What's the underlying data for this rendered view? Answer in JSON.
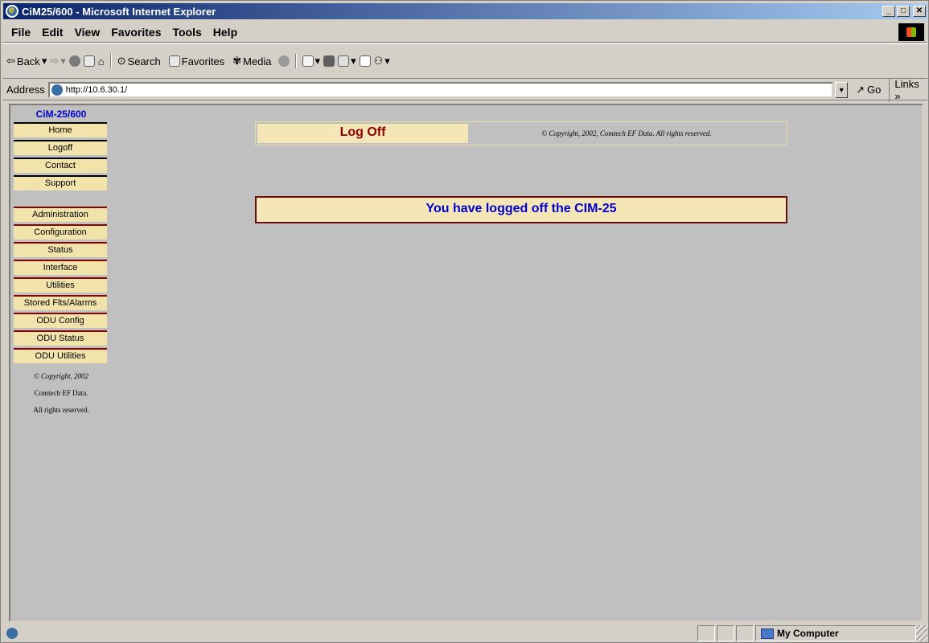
{
  "window": {
    "title": "CiM25/600 - Microsoft Internet Explorer",
    "ctrls": [
      "_",
      "□",
      "✕"
    ]
  },
  "menu": [
    "File",
    "Edit",
    "View",
    "Favorites",
    "Tools",
    "Help"
  ],
  "toolbar": {
    "back": "Back",
    "search": "Search",
    "favorites": "Favorites",
    "media": "Media"
  },
  "address": {
    "label": "Address",
    "url": "http://10.6.30.1/",
    "go": "Go",
    "links": "Links"
  },
  "nav": {
    "brand": "CiM-25/600",
    "top_items": [
      "Home",
      "Logoff",
      "Contact",
      "Support"
    ],
    "items": [
      "Administration",
      "Configuration",
      "Status",
      "Interface",
      "Utilities",
      "Stored Flts/Alarms",
      "ODU Config",
      "ODU Status",
      "ODU Utilities"
    ],
    "footer": [
      "© Copyright, 2002",
      "Comtech EF Data.",
      "All rights reserved."
    ]
  },
  "main": {
    "title": "Log Off",
    "copyright": "© Copyright, 2002, Comtech EF Data. All rights reserved.",
    "message": "You have logged off the CIM-25"
  },
  "status": {
    "zone": "My Computer"
  }
}
